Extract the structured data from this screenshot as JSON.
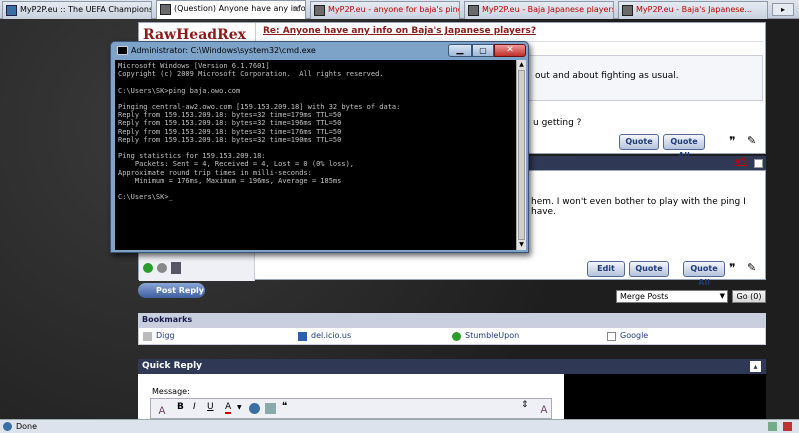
{
  "browser": {
    "tabs": [
      {
        "label": "MyP2P.eu :: The UEFA Champions Le...",
        "active": false,
        "color": "normal"
      },
      {
        "label": "(Question) Anyone have any info o...",
        "active": true,
        "color": "normal"
      },
      {
        "label": "MyP2P.eu - anyone for baja's ping spe...",
        "active": false,
        "color": "red"
      },
      {
        "label": "MyP2P.eu - Baja Japanese players...",
        "active": false,
        "color": "red"
      },
      {
        "label": "MyP2P.eu - Baja's Japanese...",
        "active": false,
        "color": "red"
      }
    ],
    "status": "Done"
  },
  "forum": {
    "username": "RawHeadRex",
    "post_title": "Re: Anyone have any info on Baja's Japanese players?",
    "post_text_1": "out and about fighting as usual.",
    "post_text_2": "u getting ?",
    "post_number": "#5",
    "reply_text": "hem. I won't even bother to play with the ping I have.",
    "quote_label": "Quote",
    "quote_all_label": "Quote All",
    "edit_label": "Edit",
    "post_reply_label": "Post Reply",
    "merge_select": "Merge Posts",
    "go_label": "Go (0)",
    "bookmarks_title": "Bookmarks",
    "bookmarks": [
      "Digg",
      "del.icio.us",
      "StumbleUpon",
      "Google"
    ],
    "quick_reply_title": "Quick Reply",
    "message_label": "Message:"
  },
  "cmd": {
    "title": "Administrator: C:\\Windows\\system32\\cmd.exe",
    "lines": [
      "Microsoft Windows [Version 6.1.7601]",
      "Copyright (c) 2009 Microsoft Corporation.  All rights reserved.",
      "",
      "C:\\Users\\SK>ping baja.owo.com",
      "",
      "Pinging central-aw2.owo.com [159.153.209.18] with 32 bytes of data:",
      "Reply from 159.153.209.18: bytes=32 time=179ms TTL=50",
      "Reply from 159.153.209.18: bytes=32 time=196ms TTL=50",
      "Reply from 159.153.209.18: bytes=32 time=176ms TTL=50",
      "Reply from 159.153.209.18: bytes=32 time=190ms TTL=50",
      "",
      "Ping statistics for 159.153.209.18:",
      "    Packets: Sent = 4, Received = 4, Lost = 0 (0% loss),",
      "Approximate round trip times in milli-seconds:",
      "    Minimum = 176ms, Maximum = 196ms, Average = 185ms",
      "",
      "C:\\Users\\SK>_"
    ]
  }
}
